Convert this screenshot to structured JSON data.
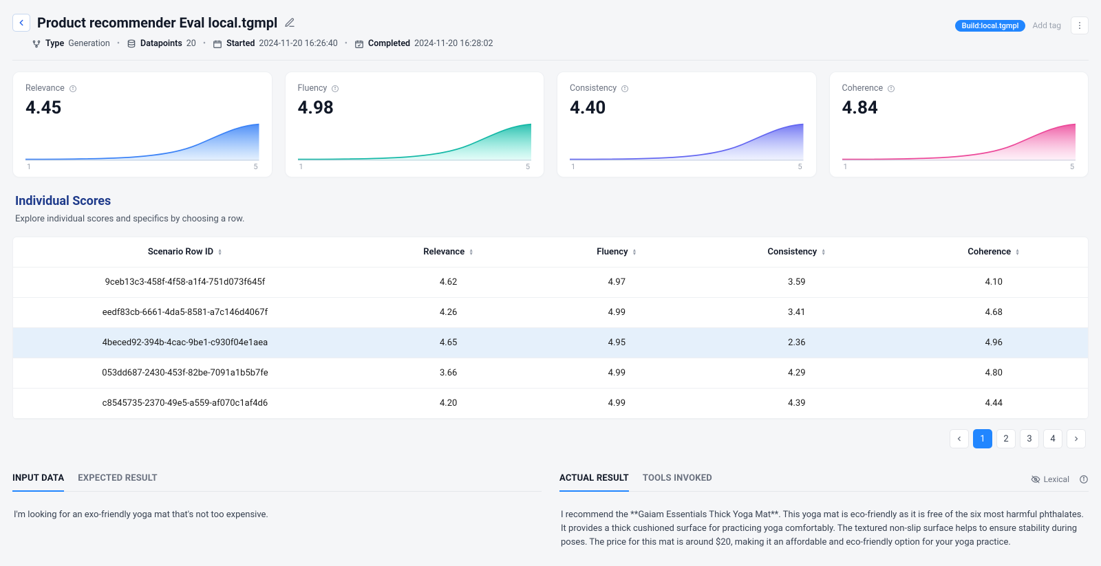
{
  "header": {
    "title": "Product recommender Eval local.tgmpl",
    "meta": {
      "type_label": "Type",
      "type_value": "Generation",
      "datapoints_label": "Datapoints",
      "datapoints_value": "20",
      "started_label": "Started",
      "started_value": "2024-11-20 16:26:40",
      "completed_label": "Completed",
      "completed_value": "2024-11-20 16:28:02"
    },
    "tag_chip": "Build:local.tgmpl",
    "add_tag": "Add tag"
  },
  "metrics": [
    {
      "label": "Relevance",
      "value": "4.45",
      "gradient_from": "#3b82f6",
      "gradient_to": "#60a5fa"
    },
    {
      "label": "Fluency",
      "value": "4.98",
      "gradient_from": "#14b8a6",
      "gradient_to": "#5eead4"
    },
    {
      "label": "Consistency",
      "value": "4.40",
      "gradient_from": "#6366f1",
      "gradient_to": "#a5b4fc"
    },
    {
      "label": "Coherence",
      "value": "4.84",
      "gradient_from": "#ec4899",
      "gradient_to": "#f9a8d4"
    }
  ],
  "axis": {
    "min": "1",
    "max": "5"
  },
  "section": {
    "title": "Individual Scores",
    "subtitle": "Explore individual scores and specifics by choosing a row."
  },
  "columns": {
    "scenario": "Scenario Row ID",
    "relevance": "Relevance",
    "fluency": "Fluency",
    "consistency": "Consistency",
    "coherence": "Coherence"
  },
  "rows": [
    {
      "id": "9ceb13c3-458f-4f58-a1f4-751d073f645f",
      "relevance": "4.62",
      "fluency": "4.97",
      "consistency": "3.59",
      "coherence": "4.10",
      "selected": false
    },
    {
      "id": "eedf83cb-6661-4da5-8581-a7c146d4067f",
      "relevance": "4.26",
      "fluency": "4.99",
      "consistency": "3.41",
      "coherence": "4.68",
      "selected": false
    },
    {
      "id": "4beced92-394b-4cac-9be1-c930f04e1aea",
      "relevance": "4.65",
      "fluency": "4.95",
      "consistency": "2.36",
      "coherence": "4.96",
      "selected": true
    },
    {
      "id": "053dd687-2430-453f-82be-7091a1b5b7fe",
      "relevance": "3.66",
      "fluency": "4.99",
      "consistency": "4.29",
      "coherence": "4.80",
      "selected": false
    },
    {
      "id": "c8545735-2370-49e5-a559-af070c1af4d6",
      "relevance": "4.20",
      "fluency": "4.99",
      "consistency": "4.39",
      "coherence": "4.44",
      "selected": false
    }
  ],
  "pagination": {
    "pages": [
      "1",
      "2",
      "3",
      "4"
    ],
    "active": "1"
  },
  "details": {
    "left_tabs": {
      "input": "INPUT DATA",
      "expected": "EXPECTED RESULT"
    },
    "right_tabs": {
      "actual": "ACTUAL RESULT",
      "tools": "TOOLS INVOKED"
    },
    "lexical_label": "Lexical",
    "input_text": "I'm looking for an exo-friendly yoga mat that's not too expensive.",
    "actual_text": "I recommend the **Gaiam Essentials Thick Yoga Mat**. This yoga mat is eco-friendly as it is free of the six most harmful phthalates. It provides a thick cushioned surface for practicing yoga comfortably. The textured non-slip surface helps to ensure stability during poses. The price for this mat is around $20, making it an affordable and eco-friendly option for your yoga practice."
  },
  "chart_data": {
    "type": "bar",
    "note": "Summary metric cards show density-style curves over score range 1–5; exact distribution not labeled. Table lists per-row metric scores.",
    "metrics_summary": [
      {
        "metric": "Relevance",
        "mean": 4.45
      },
      {
        "metric": "Fluency",
        "mean": 4.98
      },
      {
        "metric": "Consistency",
        "mean": 4.4
      },
      {
        "metric": "Coherence",
        "mean": 4.84
      }
    ],
    "x_range": [
      1,
      5
    ],
    "per_row_scores": [
      {
        "row": "9ceb13c3-458f-4f58-a1f4-751d073f645f",
        "Relevance": 4.62,
        "Fluency": 4.97,
        "Consistency": 3.59,
        "Coherence": 4.1
      },
      {
        "row": "eedf83cb-6661-4da5-8581-a7c146d4067f",
        "Relevance": 4.26,
        "Fluency": 4.99,
        "Consistency": 3.41,
        "Coherence": 4.68
      },
      {
        "row": "4beced92-394b-4cac-9be1-c930f04e1aea",
        "Relevance": 4.65,
        "Fluency": 4.95,
        "Consistency": 2.36,
        "Coherence": 4.96
      },
      {
        "row": "053dd687-2430-453f-82be-7091a1b5b7fe",
        "Relevance": 3.66,
        "Fluency": 4.99,
        "Consistency": 4.29,
        "Coherence": 4.8
      },
      {
        "row": "c8545735-2370-49e5-a559-af070c1af4d6",
        "Relevance": 4.2,
        "Fluency": 4.99,
        "Consistency": 4.39,
        "Coherence": 4.44
      }
    ]
  }
}
